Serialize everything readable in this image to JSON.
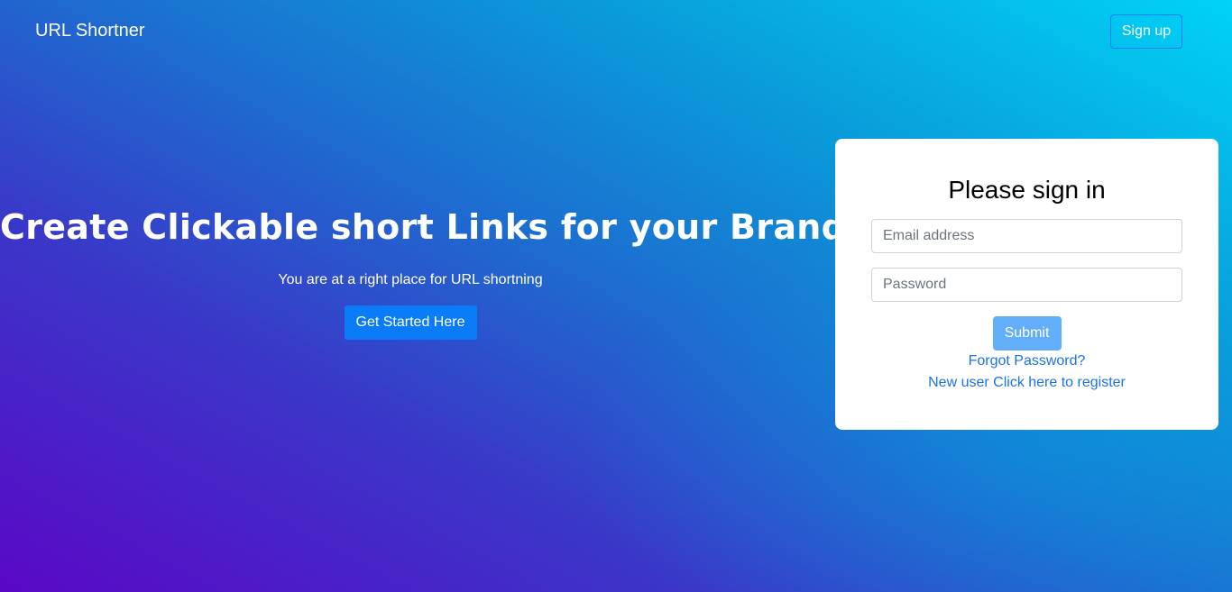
{
  "navbar": {
    "brand": "URL Shortner",
    "signup_label": "Sign up"
  },
  "hero": {
    "title": "Create Clickable short Links for your Brand",
    "subtitle": "You are at a right place for URL shortning",
    "cta_label": "Get Started Here"
  },
  "signin": {
    "title": "Please sign in",
    "email_placeholder": "Email address",
    "password_placeholder": "Password",
    "submit_label": "Submit",
    "forgot_label": "Forgot Password?",
    "register_label": "New user Click here to register"
  },
  "colors": {
    "gradient_start": "#5a08c6",
    "gradient_end": "#00d3f7",
    "primary_button": "#0a7cf7",
    "submit_button": "#63aef8",
    "link": "#1a73e8"
  }
}
